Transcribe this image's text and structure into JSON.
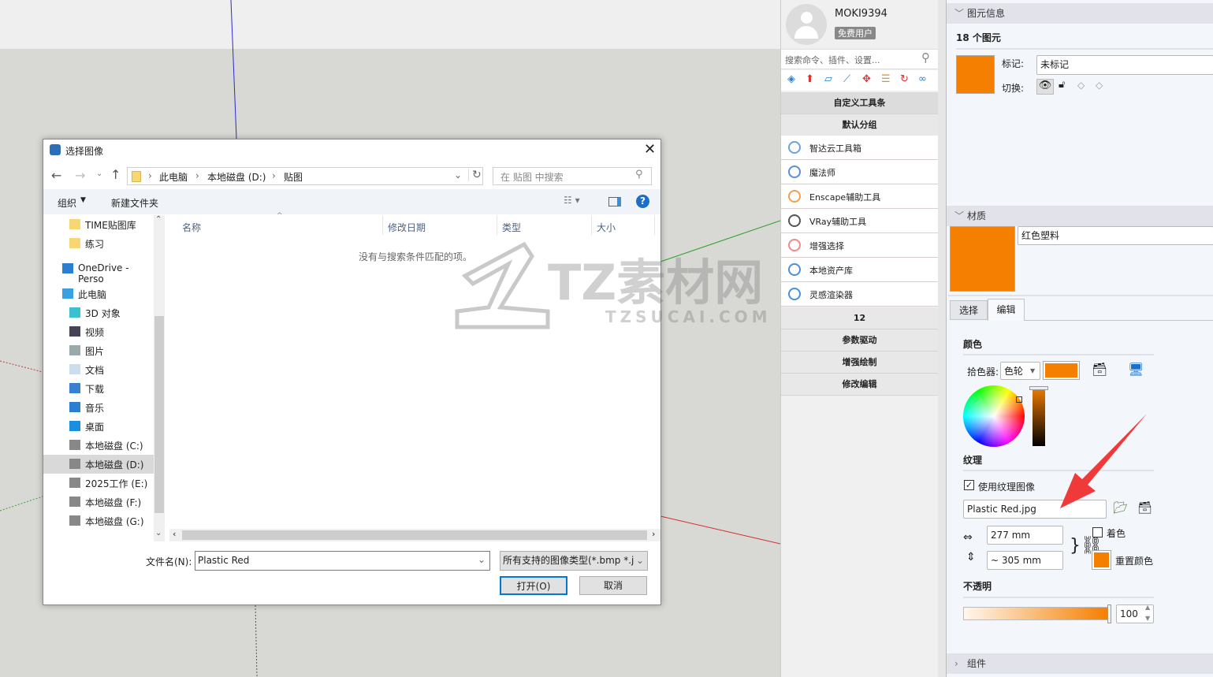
{
  "viewport": {
    "watermark": {
      "brand": "TZ素材网",
      "domain": "TZSUCAI.COM"
    }
  },
  "dialog": {
    "title": "选择图像",
    "close_icon": "close-icon",
    "breadcrumb": [
      "此电脑",
      "本地磁盘 (D:)",
      "贴图"
    ],
    "search_placeholder": "在 贴图 中搜索",
    "toolbar": {
      "organize": "组织",
      "new_folder": "新建文件夹"
    },
    "nav_items": [
      {
        "label": "TIME贴图库",
        "icon": "folder-icon"
      },
      {
        "label": "练习",
        "icon": "folder-icon"
      },
      {
        "label": "OneDrive - Perso",
        "icon": "cloud-icon"
      },
      {
        "label": "此电脑",
        "icon": "computer-icon"
      },
      {
        "label": "3D 对象",
        "icon": "cube-icon"
      },
      {
        "label": "视频",
        "icon": "video-icon"
      },
      {
        "label": "图片",
        "icon": "picture-icon"
      },
      {
        "label": "文档",
        "icon": "document-icon"
      },
      {
        "label": "下载",
        "icon": "download-icon"
      },
      {
        "label": "音乐",
        "icon": "music-icon"
      },
      {
        "label": "桌面",
        "icon": "desktop-icon"
      },
      {
        "label": "本地磁盘 (C:)",
        "icon": "drive-icon"
      },
      {
        "label": "本地磁盘 (D:)",
        "icon": "drive-icon",
        "selected": true
      },
      {
        "label": "2025工作 (E:)",
        "icon": "drive-icon"
      },
      {
        "label": "本地磁盘 (F:)",
        "icon": "drive-icon"
      },
      {
        "label": "本地磁盘 (G:)",
        "icon": "drive-icon"
      }
    ],
    "columns": [
      "名称",
      "修改日期",
      "类型",
      "大小"
    ],
    "empty_message": "没有与搜索条件匹配的项。",
    "filename_label": "文件名(N):",
    "filename_value": "Plastic Red",
    "filetype_value": "所有支持的图像类型(*.bmp *.j",
    "open_button": "打开(O)",
    "cancel_button": "取消"
  },
  "plugin_panel": {
    "username": "MOKI9394",
    "badge": "免费用户",
    "search_placeholder": "搜索命令、插件、设置...",
    "custom_toolbar": "自定义工具条",
    "default_group": "默认分组",
    "items": [
      {
        "label": "智达云工具箱",
        "color": "#6fa0e0"
      },
      {
        "label": "魔法师",
        "color": "#5b8fd6"
      },
      {
        "label": "Enscape辅助工具",
        "color": "#f0a050"
      },
      {
        "label": "VRay辅助工具",
        "color": "#555555"
      },
      {
        "label": "增强选择",
        "color": "#f08a8a"
      },
      {
        "label": "本地资产库",
        "color": "#4a90d9"
      },
      {
        "label": "灵感渲染器",
        "color": "#4a90d9"
      }
    ],
    "groups": [
      "12",
      "参数驱动",
      "增强绘制",
      "修改编辑"
    ]
  },
  "entity_info": {
    "section_title": "图元信息",
    "count_label": "18 个图元",
    "tag_label": "标记:",
    "tag_value": "未标记",
    "toggle_label": "切换:",
    "swatch_color": "#f57f00"
  },
  "material": {
    "section_title": "材质",
    "name": "红色塑料",
    "tabs": [
      "选择",
      "编辑"
    ],
    "color_heading": "颜色",
    "picker_label": "拾色器:",
    "picker_value": "色轮",
    "texture_heading": "纹理",
    "use_texture_label": "使用纹理图像",
    "use_texture_checked": true,
    "texture_file": "Plastic Red.jpg",
    "width_value": "277 mm",
    "height_value": "~ 305 mm",
    "colorize_label": "着色",
    "reset_color_label": "重置颜色",
    "opacity_heading": "不透明",
    "opacity_value": "100",
    "color": "#f57f00"
  },
  "components": {
    "section_title": "组件"
  }
}
